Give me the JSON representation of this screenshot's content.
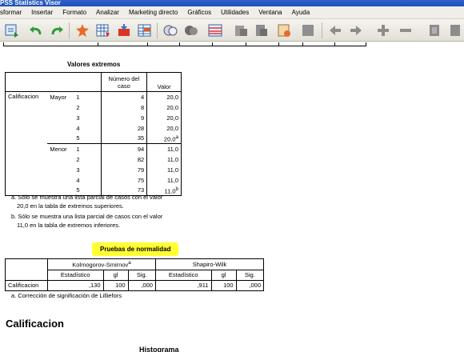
{
  "window": {
    "title": "PSS Statistics Visor"
  },
  "menu": [
    "sformar",
    "Insertar",
    "Formato",
    "Analizar",
    "Marketing directo",
    "Gráficos",
    "Utilidades",
    "Ventana",
    "Ayuda"
  ],
  "toolbar": {
    "icons": [
      "open-output-icon",
      "undo-icon",
      "redo-icon",
      "goto-data-icon",
      "goto-case-icon",
      "variables-icon",
      "select-cases-icon",
      "insert-chart-icon",
      "circle-icon",
      "dark-circle-icon",
      "pivot-icon",
      "export-icon",
      "designate-window-icon",
      "edit-icon",
      "disabled-icon",
      "back-arrow-icon",
      "forward-arrow-icon",
      "expand-plus-icon",
      "collapse-minus-icon",
      "show-icon",
      "hide-icon"
    ]
  },
  "extremes": {
    "title": "Valores extremos",
    "col_case": "Número del caso",
    "col_value": "Valor",
    "variable": "Calificacion",
    "groups": [
      {
        "label": "Mayor",
        "rows": [
          {
            "rank": "1",
            "case": "4",
            "value": "20,0",
            "sup": ""
          },
          {
            "rank": "2",
            "case": "8",
            "value": "20,0",
            "sup": ""
          },
          {
            "rank": "3",
            "case": "9",
            "value": "20,0",
            "sup": ""
          },
          {
            "rank": "4",
            "case": "28",
            "value": "20,0",
            "sup": ""
          },
          {
            "rank": "5",
            "case": "35",
            "value": "20,0",
            "sup": "a"
          }
        ]
      },
      {
        "label": "Menor",
        "rows": [
          {
            "rank": "1",
            "case": "94",
            "value": "11,0",
            "sup": ""
          },
          {
            "rank": "2",
            "case": "82",
            "value": "11,0",
            "sup": ""
          },
          {
            "rank": "3",
            "case": "79",
            "value": "11,0",
            "sup": ""
          },
          {
            "rank": "4",
            "case": "75",
            "value": "11,0",
            "sup": ""
          },
          {
            "rank": "5",
            "case": "73",
            "value": "11,0",
            "sup": "b"
          }
        ]
      }
    ],
    "footnotes": [
      [
        "a. Sólo se muestra una lista parcial de casos con el valor",
        "20,0 en la tabla de extremos superiores."
      ],
      [
        "b. Sólo se muestra una lista parcial de casos con el valor",
        "11,0 en la tabla de extremos inferiores."
      ]
    ]
  },
  "normality": {
    "title": "Pruebas de normalidad",
    "ks_header": "Kolmogorov-Smirnov",
    "ks_sup": "a",
    "sw_header": "Shapiro-Wilk",
    "subheaders": [
      "Estadístico",
      "gl",
      "Sig.",
      "Estadístico",
      "gl",
      "Sig."
    ],
    "row_label": "Calificacion",
    "values": [
      ",130",
      "100",
      ",000",
      ",911",
      "100",
      ",000"
    ],
    "footnote": "a. Corrección de significación de Lilliefors"
  },
  "section_title": "Calificacion",
  "histogram_title": "Histograma",
  "colors": {
    "highlight": "#ffff33",
    "titlebar": "#2f63c9"
  }
}
